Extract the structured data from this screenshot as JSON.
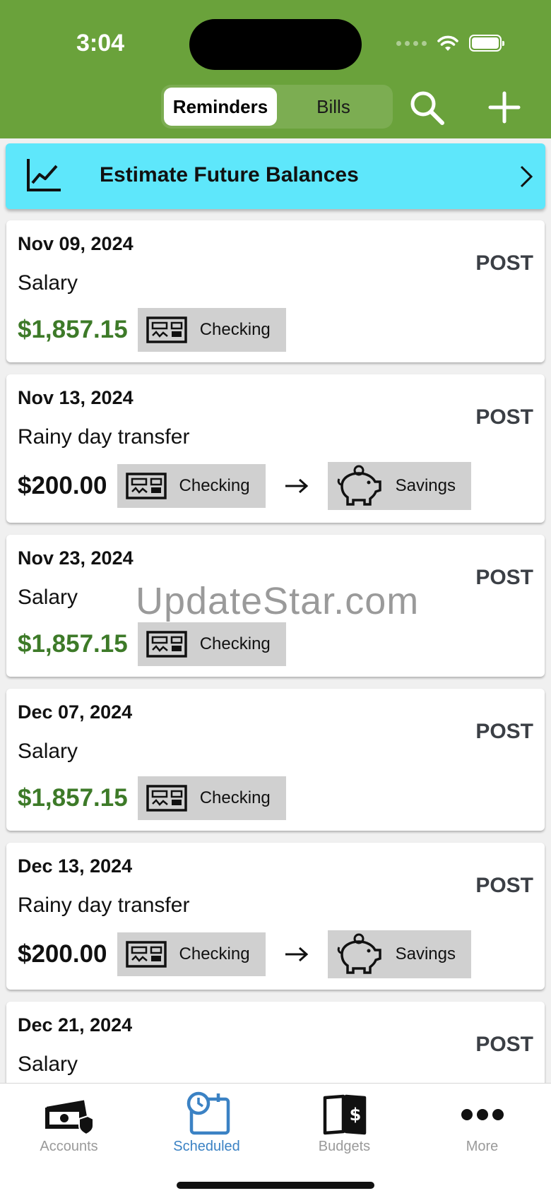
{
  "status": {
    "time": "3:04"
  },
  "header": {
    "segments": [
      {
        "label": "Reminders",
        "active": true
      },
      {
        "label": "Bills",
        "active": false
      }
    ],
    "search_icon": "search-icon",
    "add_icon": "plus-icon",
    "bg_color": "#6aa23b"
  },
  "estimate": {
    "label": "Estimate Future Balances",
    "icon": "line-chart-icon",
    "bg_color": "#5ee7fb"
  },
  "cards": [
    {
      "date": "Nov 09, 2024",
      "title": "Salary",
      "amount": "$1,857.15",
      "type": "income",
      "from": "Checking",
      "post": "POST"
    },
    {
      "date": "Nov 13, 2024",
      "title": "Rainy day transfer",
      "amount": "$200.00",
      "type": "transfer",
      "from": "Checking",
      "to": "Savings",
      "post": "POST"
    },
    {
      "date": "Nov 23, 2024",
      "title": "Salary",
      "amount": "$1,857.15",
      "type": "income",
      "from": "Checking",
      "post": "POST"
    },
    {
      "date": "Dec 07, 2024",
      "title": "Salary",
      "amount": "$1,857.15",
      "type": "income",
      "from": "Checking",
      "post": "POST"
    },
    {
      "date": "Dec 13, 2024",
      "title": "Rainy day transfer",
      "amount": "$200.00",
      "type": "transfer",
      "from": "Checking",
      "to": "Savings",
      "post": "POST"
    },
    {
      "date": "Dec 21, 2024",
      "title": "Salary",
      "post": "POST"
    }
  ],
  "watermark": "UpdateStar.com",
  "tabs": [
    {
      "label": "Accounts",
      "icon": "accounts-icon",
      "active": false
    },
    {
      "label": "Scheduled",
      "icon": "calendar-clock-icon",
      "active": true
    },
    {
      "label": "Budgets",
      "icon": "budget-book-icon",
      "active": false
    },
    {
      "label": "More",
      "icon": "more-icon",
      "active": false
    }
  ],
  "colors": {
    "income": "#3d7a28",
    "active_tab": "#3b82c4",
    "chip": "#d0d0d0"
  }
}
